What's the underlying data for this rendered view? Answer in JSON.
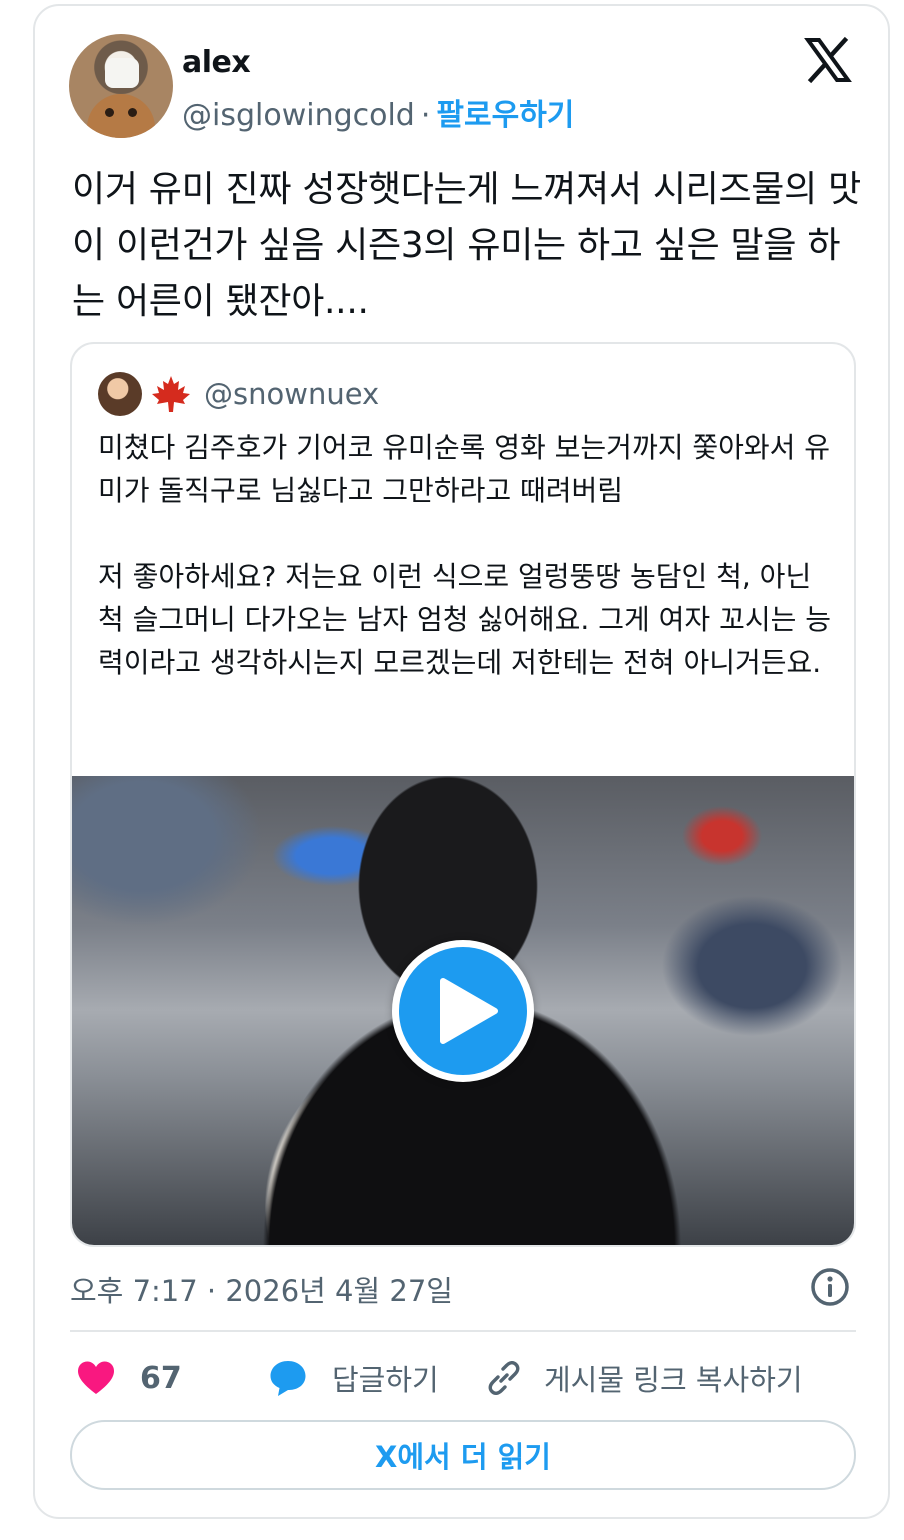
{
  "user": {
    "name": "alex",
    "handle": "@isglowingcold",
    "separator": "·",
    "follow_label": "팔로우하기"
  },
  "tweet": {
    "text": "이거 유미 진짜 성장햇다는게 느껴져서 시리즈물의 맛이 이런건가 싶음 시즌3의 유미는 하고 싶은 말을 하는 어른이 됐잔아...."
  },
  "quoted": {
    "handle": "@snownuex",
    "text": "미쳤다 김주호가 기어코 유미순록 영화 보는거까지 쫓아와서 유미가 돌직구로 님싫다고 그만하라고 때려버림\n\n저 좋아하세요? 저는요 이런 식으로 얼렁뚱땅 농담인 척, 아닌 척 슬그머니 다가오는 남자 엄청 싫어해요. 그게 여자 꼬시는 능력이라고 생각하시는지 모르겠는데 저한테는 전혀 아니거든요."
  },
  "meta": {
    "timestamp": "오후 7:17 · 2026년 4월 27일"
  },
  "actions": {
    "like_count": "67",
    "reply_label": "답글하기",
    "copy_link_label": "게시물 링크 복사하기"
  },
  "read_more_label": "X에서 더 읽기",
  "icons": [
    "x-logo-icon",
    "maple-leaf-icon",
    "play-icon",
    "info-icon",
    "heart-icon",
    "reply-bubble-icon",
    "link-icon"
  ],
  "colors": {
    "accent": "#1d9bf0",
    "like": "#f91880",
    "secondary_text": "#536471",
    "border": "#e3e6e8"
  }
}
